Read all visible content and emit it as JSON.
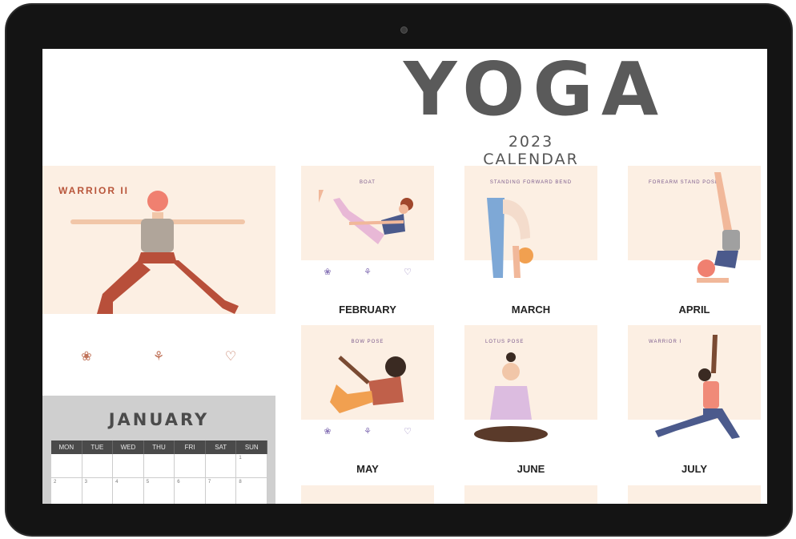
{
  "header": {
    "title": "YOGA",
    "subtitle": "2023 CALENDAR"
  },
  "cover": {
    "pose": "WARRIOR II"
  },
  "january": {
    "title": "JANUARY",
    "days": [
      "MON",
      "TUE",
      "WED",
      "THU",
      "FRI",
      "SAT",
      "SUN"
    ],
    "cells": [
      "",
      "",
      "",
      "",
      "",
      "",
      "1",
      "2",
      "3",
      "4",
      "5",
      "6",
      "7",
      "8"
    ]
  },
  "months": [
    {
      "month": "FEBRUARY",
      "pose": "BOAT"
    },
    {
      "month": "MARCH",
      "pose": "STANDING FORWARD BEND"
    },
    {
      "month": "APRIL",
      "pose": "FOREARM STAND POSE"
    },
    {
      "month": "MAY",
      "pose": "BOW POSE"
    },
    {
      "month": "JUNE",
      "pose": "LOTUS POSE"
    },
    {
      "month": "JULY",
      "pose": "WARRIOR I"
    }
  ],
  "colors": {
    "card_bg": "#fcefe3",
    "title_gray": "#5a5a5a",
    "accent_purple": "#7a5a8c",
    "accent_rust": "#b8553a"
  },
  "icons": [
    "lotus-icon",
    "meditation-icon",
    "heart-icon"
  ]
}
